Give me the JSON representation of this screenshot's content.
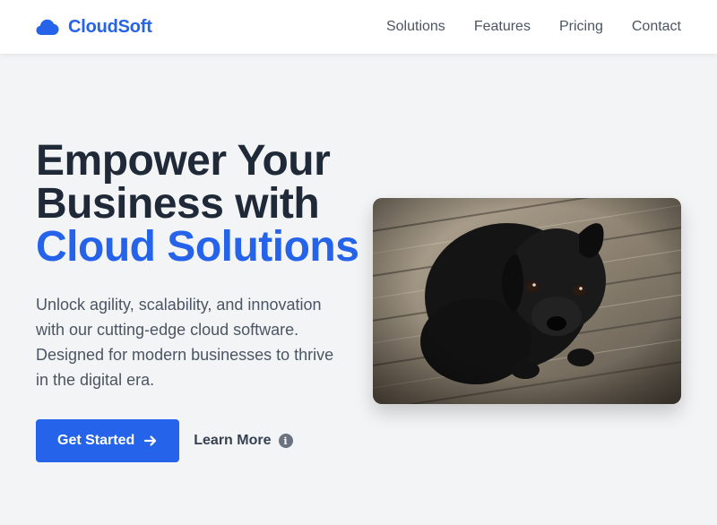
{
  "header": {
    "brand_name": "CloudSoft",
    "brand_icon": "cloud-icon",
    "nav": [
      "Solutions",
      "Features",
      "Pricing",
      "Contact"
    ]
  },
  "hero": {
    "title_line1": "Empower Your",
    "title_line2": "Business with",
    "title_accent": "Cloud Solutions",
    "subtitle": "Unlock agility, scalability, and innovation with our cutting-edge cloud software. Designed for modern businesses to thrive in the digital era.",
    "primary_button": "Get Started",
    "primary_icon": "arrow-right-icon",
    "secondary_button": "Learn More",
    "secondary_icon": "info-icon",
    "image": "photo of a black puppy on wooden floorboards"
  },
  "colors": {
    "accent": "#2563eb",
    "heading": "#1f2937",
    "body": "#4b5563",
    "background": "#f3f4f6"
  }
}
